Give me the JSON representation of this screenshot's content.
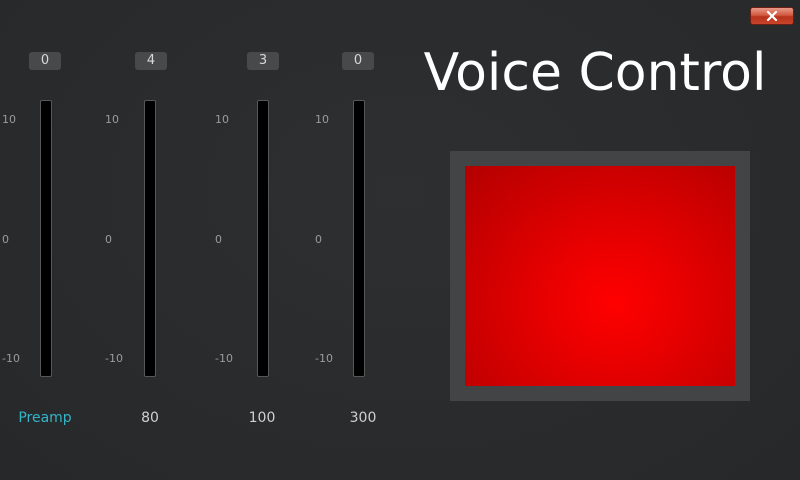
{
  "window": {
    "close_icon": "close-x-icon",
    "close_color": "#c8442a"
  },
  "title": "Voice Control",
  "sliders": [
    {
      "value": "0",
      "label": "Preamp",
      "active": true,
      "ticks": {
        "top": "10",
        "mid": "0",
        "bottom": "-10"
      }
    },
    {
      "value": "4",
      "label": "80",
      "active": false,
      "ticks": {
        "top": "10",
        "mid": "0",
        "bottom": "-10"
      }
    },
    {
      "value": "3",
      "label": "100",
      "active": false,
      "ticks": {
        "top": "10",
        "mid": "0",
        "bottom": "-10"
      }
    },
    {
      "value": "0",
      "label": "300",
      "active": false,
      "ticks": {
        "top": "10",
        "mid": "0",
        "bottom": "-10"
      }
    }
  ],
  "indicator": {
    "color": "#ff0000",
    "frame_color": "#434445"
  },
  "colors": {
    "background": "#2a2c2e",
    "accent": "#33b5c9",
    "text": "#ffffff"
  }
}
